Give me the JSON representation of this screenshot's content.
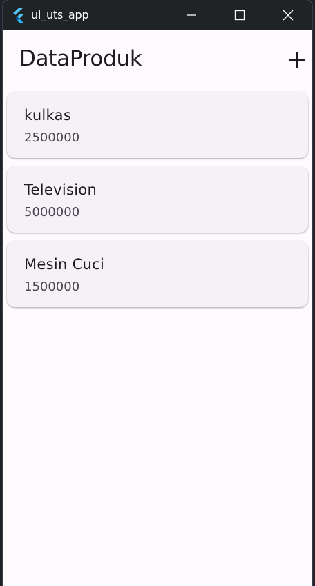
{
  "window": {
    "title": "ui_uts_app"
  },
  "appbar": {
    "title": "DataProduk",
    "add_icon": "add-icon"
  },
  "products": [
    {
      "name": "kulkas",
      "price": "2500000"
    },
    {
      "name": "Television",
      "price": "5000000"
    },
    {
      "name": "Mesin Cuci",
      "price": "1500000"
    }
  ],
  "colors": {
    "titlebar": "#202326",
    "surface": "#fefbff",
    "card": "#f5f1f7",
    "text_primary": "#1d1b20",
    "text_secondary": "#49454f",
    "flutter_light": "#54c5f8",
    "flutter_dark": "#01579b"
  }
}
